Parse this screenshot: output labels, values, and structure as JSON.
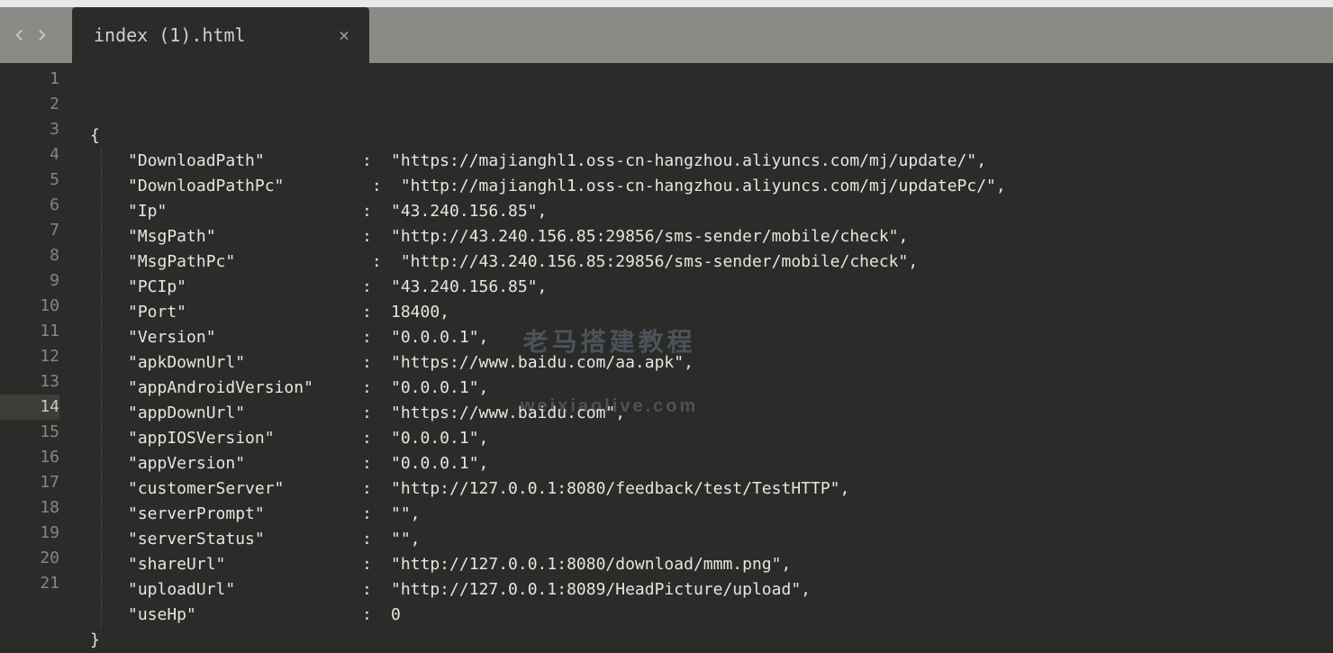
{
  "tab": {
    "title": "index (1).html"
  },
  "active_line": 14,
  "total_lines": 21,
  "watermark": {
    "line1": "老马搭建教程",
    "line2": "weixiaolive.com"
  },
  "code": {
    "open": "{",
    "close": "}",
    "entries": [
      {
        "key": "\"DownloadPath\"",
        "keypad": "\"DownloadPath\"      ",
        "colon": ": ",
        "value": "\"https://majianghl1.oss-cn-hangzhou.aliyuncs.com/mj/update/\",",
        "extra_indent": ""
      },
      {
        "key": "\"DownloadPathPc\"",
        "keypad": "\"DownloadPathPc\"    ",
        "colon": " :",
        "value": " \"http://majianghl1.oss-cn-hangzhou.aliyuncs.com/mj/updatePc/\",",
        "extra_indent": ""
      },
      {
        "key": "\"Ip\"",
        "keypad": "\"Ip\"                ",
        "colon": ": ",
        "value": "\"43.240.156.85\",",
        "extra_indent": ""
      },
      {
        "key": "\"MsgPath\"",
        "keypad": "\"MsgPath\"           ",
        "colon": ": ",
        "value": "\"http://43.240.156.85:29856/sms-sender/mobile/check\",",
        "extra_indent": ""
      },
      {
        "key": "\"MsgPathPc\"",
        "keypad": "\"MsgPathPc\"         ",
        "colon": " :",
        "value": " \"http://43.240.156.85:29856/sms-sender/mobile/check\",",
        "extra_indent": ""
      },
      {
        "key": "\"PCIp\"",
        "keypad": "\"PCIp\"              ",
        "colon": ": ",
        "value": "\"43.240.156.85\",",
        "extra_indent": ""
      },
      {
        "key": "\"Port\"",
        "keypad": "\"Port\"              ",
        "colon": ": ",
        "value": "18400,",
        "extra_indent": ""
      },
      {
        "key": "\"Version\"",
        "keypad": "\"Version\"           ",
        "colon": ": ",
        "value": "\"0.0.0.1\",",
        "extra_indent": ""
      },
      {
        "key": "\"apkDownUrl\"",
        "keypad": "\"apkDownUrl\"        ",
        "colon": ": ",
        "value": "\"https://www.baidu.com/aa.apk\",",
        "extra_indent": ""
      },
      {
        "key": "\"appAndroidVersion\"",
        "keypad": "\"appAndroidVersion\" ",
        "colon": ": ",
        "value": "\"0.0.0.1\",",
        "extra_indent": ""
      },
      {
        "key": "\"appDownUrl\"",
        "keypad": "\"appDownUrl\"        ",
        "colon": ": ",
        "value": "\"https://www.baidu.com\",",
        "extra_indent": ""
      },
      {
        "key": "\"appIOSVersion\"",
        "keypad": "\"appIOSVersion\"     ",
        "colon": ": ",
        "value": "\"0.0.0.1\",",
        "extra_indent": ""
      },
      {
        "key": "\"appVersion\"",
        "keypad": "\"appVersion\"        ",
        "colon": ": ",
        "value": "\"0.0.0.1\",",
        "extra_indent": ""
      },
      {
        "key": "\"customerServer\"",
        "keypad": "\"customerServer\"    ",
        "colon": ": ",
        "value": "\"http://127.0.0.1:8080/feedback/test/TestHTTP\",",
        "extra_indent": ""
      },
      {
        "key": "\"serverPrompt\"",
        "keypad": "\"serverPrompt\"      ",
        "colon": ": ",
        "value": "\"\",",
        "extra_indent": ""
      },
      {
        "key": "\"serverStatus\"",
        "keypad": "\"serverStatus\"      ",
        "colon": ": ",
        "value": "\"\",",
        "extra_indent": ""
      },
      {
        "key": "\"shareUrl\"",
        "keypad": "\"shareUrl\"          ",
        "colon": ": ",
        "value": "\"http://127.0.0.1:8080/download/mmm.png\",",
        "extra_indent": ""
      },
      {
        "key": "\"uploadUrl\"",
        "keypad": "\"uploadUrl\"         ",
        "colon": ": ",
        "value": "\"http://127.0.0.1:8089/HeadPicture/upload\",",
        "extra_indent": ""
      },
      {
        "key": "\"useHp\"",
        "keypad": "\"useHp\"             ",
        "colon": ": ",
        "value": "0",
        "extra_indent": ""
      }
    ]
  }
}
